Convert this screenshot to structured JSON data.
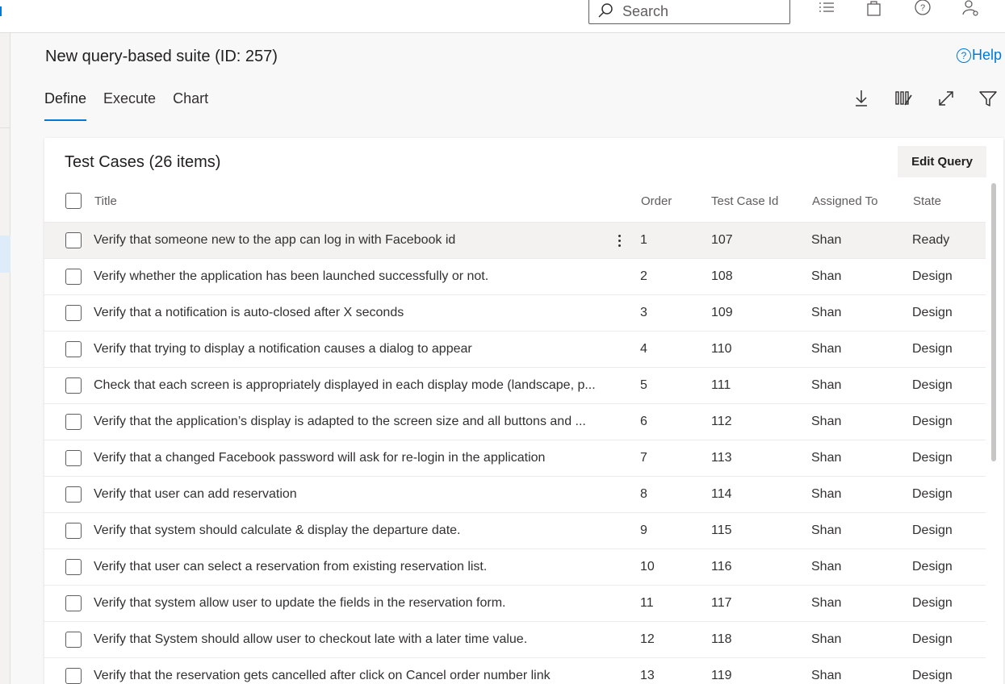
{
  "topbar": {
    "search_placeholder": "Search",
    "icons": [
      "list-icon",
      "bag-icon",
      "help-circle-icon",
      "user-settings-icon"
    ]
  },
  "header": {
    "title": "New query-based suite (ID: 257)",
    "help": "Help"
  },
  "tabs": [
    {
      "label": "Define",
      "active": true
    },
    {
      "label": "Execute",
      "active": false
    },
    {
      "label": "Chart",
      "active": false
    }
  ],
  "toolbar_icons": [
    "download-icon",
    "column-options-icon",
    "expand-icon",
    "filter-icon"
  ],
  "card": {
    "title": "Test Cases (26 items)",
    "edit_label": "Edit Query"
  },
  "columns": {
    "title": "Title",
    "order": "Order",
    "id": "Test Case Id",
    "assigned": "Assigned To",
    "state": "State"
  },
  "rows": [
    {
      "title": "Verify that someone new to the app can log in with Facebook id",
      "order": "1",
      "id": "107",
      "assigned": "Shan",
      "state": "Ready"
    },
    {
      "title": "Verify whether the application has been launched successfully or not.",
      "order": "2",
      "id": "108",
      "assigned": "Shan",
      "state": "Design"
    },
    {
      "title": "Verify that a notification is auto-closed after X seconds",
      "order": "3",
      "id": "109",
      "assigned": "Shan",
      "state": "Design"
    },
    {
      "title": "Verify that trying to display a notification causes a dialog to appear",
      "order": "4",
      "id": "110",
      "assigned": "Shan",
      "state": "Design"
    },
    {
      "title": "Check that each screen is appropriately displayed in each display mode (landscape, p...",
      "order": "5",
      "id": "111",
      "assigned": "Shan",
      "state": "Design"
    },
    {
      "title": "Verify that the application’s display is adapted to the screen size and all buttons and ...",
      "order": "6",
      "id": "112",
      "assigned": "Shan",
      "state": "Design"
    },
    {
      "title": "Verify that a changed Facebook password will ask for re-login in the application",
      "order": "7",
      "id": "113",
      "assigned": "Shan",
      "state": "Design"
    },
    {
      "title": "Verify that user can add reservation",
      "order": "8",
      "id": "114",
      "assigned": "Shan",
      "state": "Design"
    },
    {
      "title": "Verify that system should calculate & display the departure date.",
      "order": "9",
      "id": "115",
      "assigned": "Shan",
      "state": "Design"
    },
    {
      "title": "Verify that user can select a reservation from existing reservation list.",
      "order": "10",
      "id": "116",
      "assigned": "Shan",
      "state": "Design"
    },
    {
      "title": "Verify that system allow user to update the fields in the reservation form.",
      "order": "11",
      "id": "117",
      "assigned": "Shan",
      "state": "Design"
    },
    {
      "title": "Verify that System should allow user to checkout late with a later time value.",
      "order": "12",
      "id": "118",
      "assigned": "Shan",
      "state": "Design"
    },
    {
      "title": "Verify that the reservation gets cancelled after click on Cancel order number link",
      "order": "13",
      "id": "119",
      "assigned": "Shan",
      "state": "Design"
    }
  ]
}
